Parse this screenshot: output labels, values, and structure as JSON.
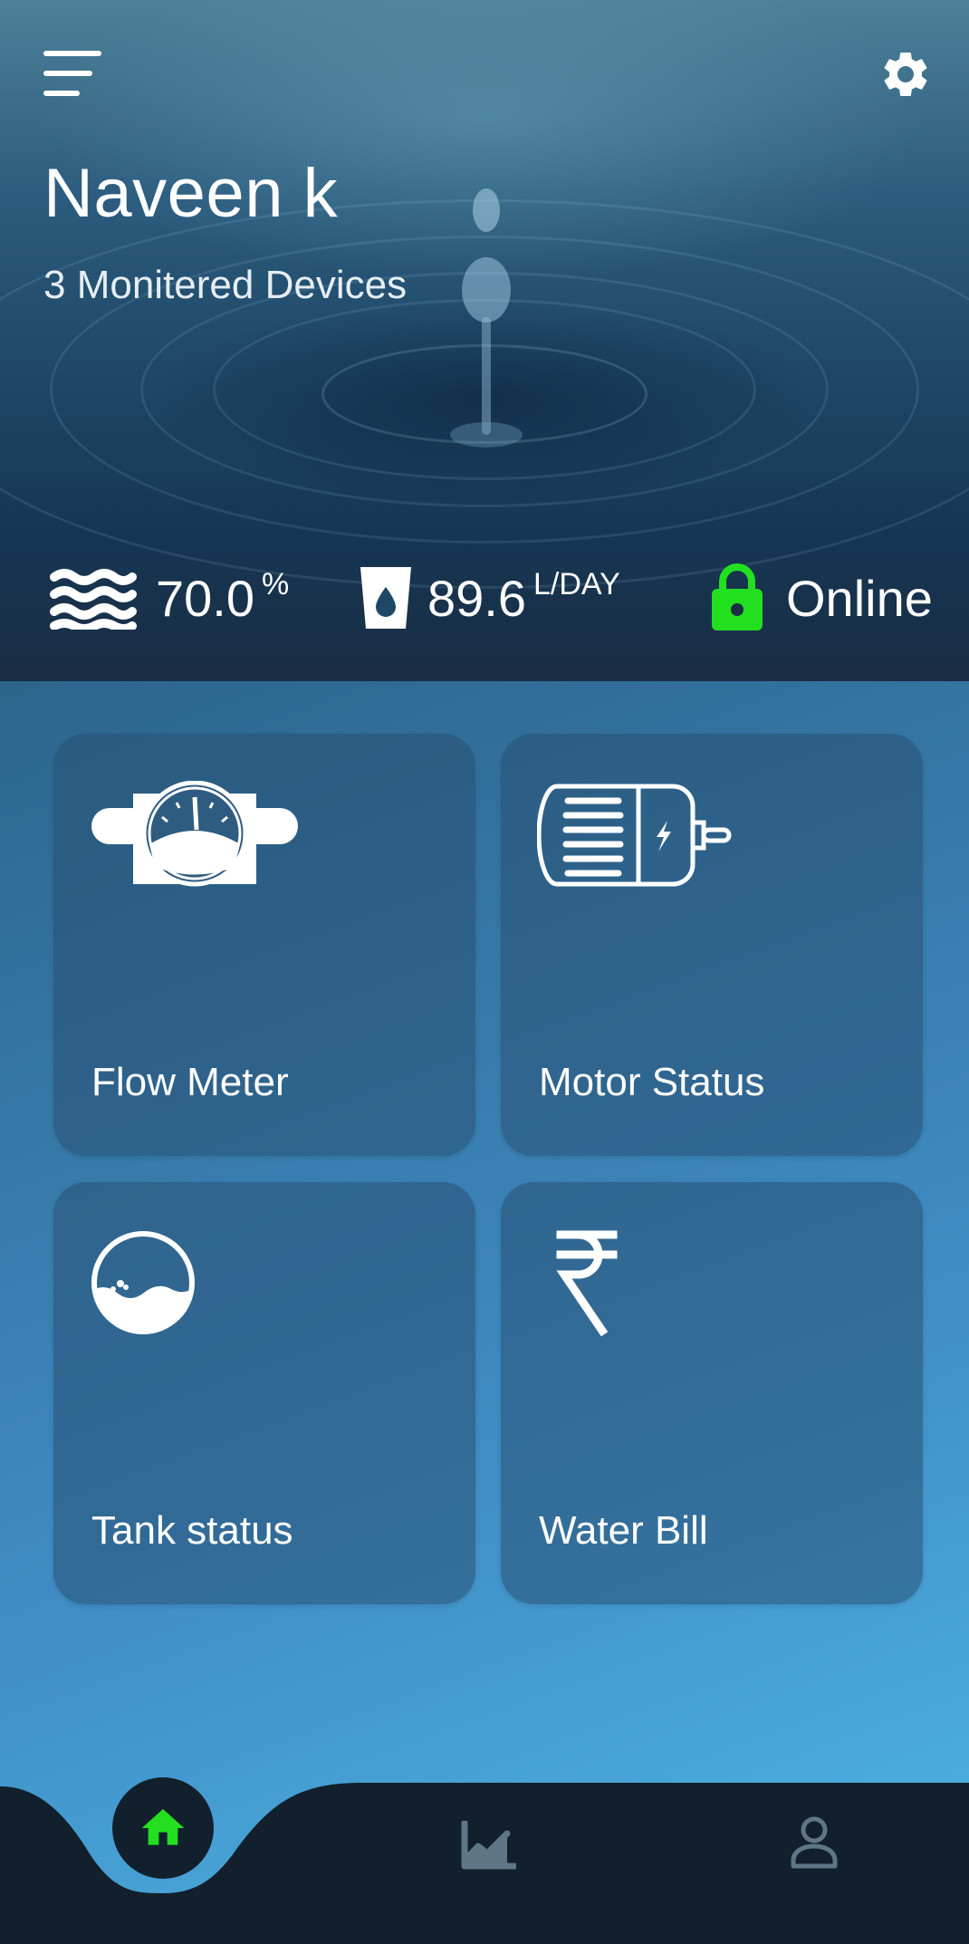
{
  "header": {
    "user_name": "Naveen k",
    "devices_text": "3 Monitered Devices",
    "menu_icon": "hamburger-menu-icon",
    "settings_icon": "gear-icon"
  },
  "stats": {
    "water_level": {
      "icon": "waves-icon",
      "value": "70.0",
      "unit": "%"
    },
    "consumption": {
      "icon": "water-glass-icon",
      "value": "89.6",
      "unit": "L/DAY"
    },
    "status": {
      "icon": "lock-icon",
      "value": "Online",
      "color": "#22e01f"
    }
  },
  "cards": [
    {
      "label": "Flow Meter",
      "icon": "flow-meter-icon"
    },
    {
      "label": "Motor Status",
      "icon": "motor-icon"
    },
    {
      "label": "Tank status",
      "icon": "tank-icon"
    },
    {
      "label": "Water Bill",
      "icon": "rupee-icon"
    }
  ],
  "nav": {
    "items": [
      {
        "icon": "home-icon",
        "active": true
      },
      {
        "icon": "chart-icon",
        "active": false
      },
      {
        "icon": "user-icon",
        "active": false
      }
    ],
    "active_color": "#22e01f",
    "background": "#11202c"
  }
}
